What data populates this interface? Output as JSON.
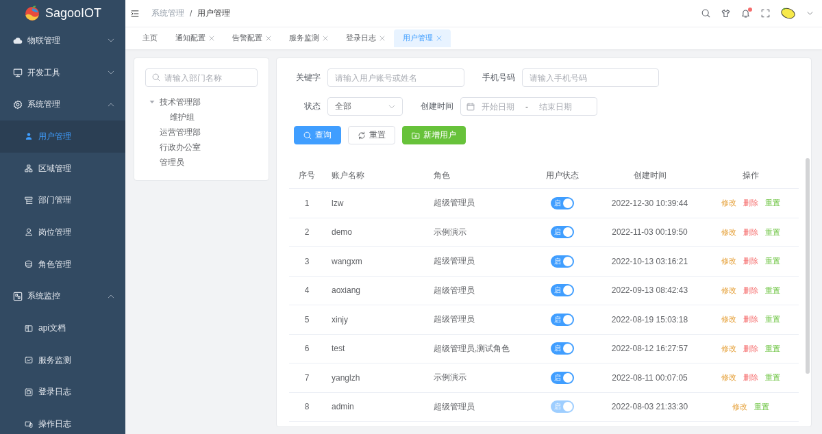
{
  "sidebar": {
    "logo": "SagooIOT",
    "items": [
      {
        "label": "物联管理",
        "expanded": false
      },
      {
        "label": "开发工具",
        "expanded": false
      },
      {
        "label": "系统管理",
        "expanded": true,
        "children": [
          {
            "label": "用户管理",
            "selected": true
          },
          {
            "label": "区域管理",
            "selected": false
          },
          {
            "label": "部门管理",
            "selected": false
          },
          {
            "label": "岗位管理",
            "selected": false
          },
          {
            "label": "角色管理",
            "selected": false
          }
        ]
      },
      {
        "label": "系统监控",
        "expanded": true,
        "children": [
          {
            "label": "api文档",
            "selected": false
          },
          {
            "label": "服务监测",
            "selected": false
          },
          {
            "label": "登录日志",
            "selected": false
          },
          {
            "label": "操作日志",
            "selected": false
          }
        ]
      }
    ]
  },
  "header": {
    "breadcrumb": [
      "系统管理",
      "用户管理"
    ],
    "breadcrumb_separator": "/",
    "unread": true
  },
  "tabs": [
    {
      "label": "主页",
      "closable": false,
      "selected": false
    },
    {
      "label": "通知配置",
      "closable": true,
      "selected": false
    },
    {
      "label": "告警配置",
      "closable": true,
      "selected": false
    },
    {
      "label": "服务监测",
      "closable": true,
      "selected": false
    },
    {
      "label": "登录日志",
      "closable": true,
      "selected": false
    },
    {
      "label": "用户管理",
      "closable": true,
      "selected": true
    }
  ],
  "dept_tree": {
    "search": {
      "placeholder": "请输入部门名称"
    },
    "nodes": [
      {
        "label": "技术管理部",
        "expanded": true,
        "children": [
          {
            "label": "维护组"
          }
        ]
      },
      {
        "label": "运营管理部"
      },
      {
        "label": "行政办公室"
      },
      {
        "label": "管理员"
      }
    ]
  },
  "filters": {
    "keyword": {
      "label": "关键字",
      "placeholder": "请输入用户账号或姓名"
    },
    "phone": {
      "label": "手机号码",
      "placeholder": "请输入手机号码"
    },
    "status": {
      "label": "状态",
      "value": "全部"
    },
    "created": {
      "label": "创建时间",
      "start_placeholder": "开始日期",
      "separator": "-",
      "end_placeholder": "结束日期"
    }
  },
  "buttons": [
    {
      "label": "查询",
      "kind": "primary"
    },
    {
      "label": "重置",
      "kind": "default"
    },
    {
      "label": "新增用户",
      "kind": "success"
    }
  ],
  "table": {
    "columns": [
      "序号",
      "账户名称",
      "角色",
      "用户状态",
      "创建时间",
      "操作"
    ],
    "rows": [
      {
        "index": "1",
        "account": "lzw",
        "role": "超级管理员",
        "status": {
          "label": "启",
          "on": true,
          "disabled": false
        },
        "created": "2022-12-30 10:39:44",
        "actions": [
          {
            "label": "修改",
            "kind": "edit"
          },
          {
            "label": "删除",
            "kind": "delete"
          },
          {
            "label": "重置",
            "kind": "reset"
          }
        ]
      },
      {
        "index": "2",
        "account": "demo",
        "role": "示例演示",
        "status": {
          "label": "启",
          "on": true,
          "disabled": false
        },
        "created": "2022-11-03 00:19:50",
        "actions": [
          {
            "label": "修改",
            "kind": "edit"
          },
          {
            "label": "删除",
            "kind": "delete"
          },
          {
            "label": "重置",
            "kind": "reset"
          }
        ]
      },
      {
        "index": "3",
        "account": "wangxm",
        "role": "超级管理员",
        "status": {
          "label": "启",
          "on": true,
          "disabled": false
        },
        "created": "2022-10-13 03:16:21",
        "actions": [
          {
            "label": "修改",
            "kind": "edit"
          },
          {
            "label": "删除",
            "kind": "delete"
          },
          {
            "label": "重置",
            "kind": "reset"
          }
        ]
      },
      {
        "index": "4",
        "account": "aoxiang",
        "role": "超级管理员",
        "status": {
          "label": "启",
          "on": true,
          "disabled": false
        },
        "created": "2022-09-13 08:42:43",
        "actions": [
          {
            "label": "修改",
            "kind": "edit"
          },
          {
            "label": "删除",
            "kind": "delete"
          },
          {
            "label": "重置",
            "kind": "reset"
          }
        ]
      },
      {
        "index": "5",
        "account": "xinjy",
        "role": "超级管理员",
        "status": {
          "label": "启",
          "on": true,
          "disabled": false
        },
        "created": "2022-08-19 15:03:18",
        "actions": [
          {
            "label": "修改",
            "kind": "edit"
          },
          {
            "label": "删除",
            "kind": "delete"
          },
          {
            "label": "重置",
            "kind": "reset"
          }
        ]
      },
      {
        "index": "6",
        "account": "test",
        "role": "超级管理员,测试角色",
        "status": {
          "label": "启",
          "on": true,
          "disabled": false
        },
        "created": "2022-08-12 16:27:57",
        "actions": [
          {
            "label": "修改",
            "kind": "edit"
          },
          {
            "label": "删除",
            "kind": "delete"
          },
          {
            "label": "重置",
            "kind": "reset"
          }
        ]
      },
      {
        "index": "7",
        "account": "yanglzh",
        "role": "示例演示",
        "status": {
          "label": "启",
          "on": true,
          "disabled": false
        },
        "created": "2022-08-11 00:07:05",
        "actions": [
          {
            "label": "修改",
            "kind": "edit"
          },
          {
            "label": "删除",
            "kind": "delete"
          },
          {
            "label": "重置",
            "kind": "reset"
          }
        ]
      },
      {
        "index": "8",
        "account": "admin",
        "role": "超级管理员",
        "status": {
          "label": "启",
          "on": true,
          "disabled": true
        },
        "created": "2022-08-03 21:33:30",
        "actions": [
          {
            "label": "修改",
            "kind": "edit"
          },
          {
            "label": "重置",
            "kind": "reset"
          }
        ]
      }
    ]
  }
}
